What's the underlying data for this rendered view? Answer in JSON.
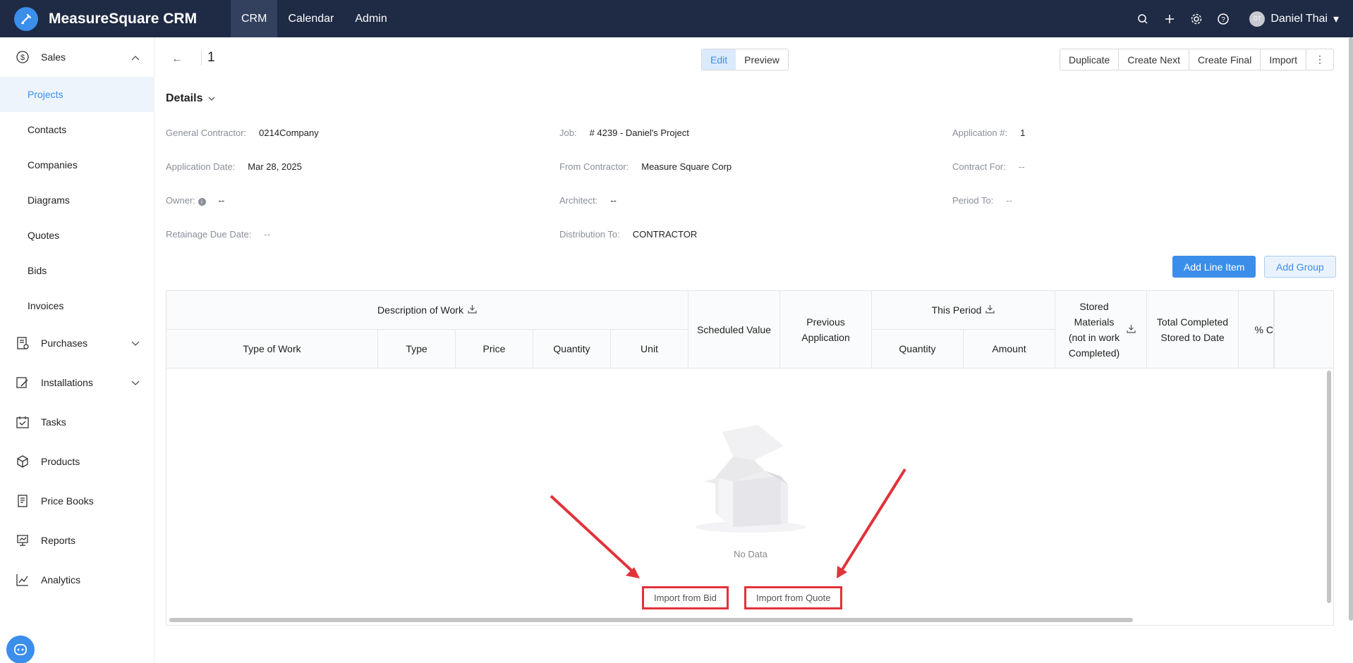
{
  "app": {
    "name": "MeasureSquare CRM"
  },
  "topnav": [
    {
      "label": "CRM"
    },
    {
      "label": "Calendar"
    },
    {
      "label": "Admin"
    }
  ],
  "user": {
    "initials": "DT",
    "name": "Daniel Thai"
  },
  "sidebar": {
    "sales": "Sales",
    "sales_items": [
      "Projects",
      "Contacts",
      "Companies",
      "Diagrams",
      "Quotes",
      "Bids",
      "Invoices"
    ],
    "groups": [
      "Purchases",
      "Installations",
      "Tasks",
      "Products",
      "Price Books",
      "Reports",
      "Analytics"
    ]
  },
  "page": {
    "doc_number": "1",
    "mode_edit": "Edit",
    "mode_preview": "Preview",
    "actions": [
      "Duplicate",
      "Create Next",
      "Create Final",
      "Import"
    ],
    "more": "⋮",
    "details_title": "Details"
  },
  "details": {
    "general_contractor_label": "General Contractor:",
    "general_contractor": "0214Company",
    "application_date_label": "Application Date:",
    "application_date": "Mar 28, 2025",
    "owner_label": "Owner:",
    "owner": "--",
    "retainage_due_label": "Retainage Due Date:",
    "retainage_due": "--",
    "job_label": "Job:",
    "job": "# 4239 - Daniel's Project",
    "from_contractor_label": "From Contractor:",
    "from_contractor": "Measure Square Corp",
    "architect_label": "Architect:",
    "architect": "--",
    "distribution_label": "Distribution To:",
    "distribution": "CONTRACTOR",
    "application_no_label": "Application #:",
    "application_no": "1",
    "contract_for_label": "Contract For:",
    "contract_for": "--",
    "period_to_label": "Period To:",
    "period_to": "--"
  },
  "buttons": {
    "add_line_item": "Add Line Item",
    "add_group": "Add Group"
  },
  "table": {
    "description_of_work": "Description of Work",
    "type_of_work": "Type of Work",
    "type": "Type",
    "price": "Price",
    "quantity": "Quantity",
    "unit": "Unit",
    "scheduled_value": "Scheduled Value",
    "previous_application": "Previous Application",
    "this_period": "This Period",
    "tp_quantity": "Quantity",
    "tp_amount": "Amount",
    "stored_materials": "Stored Materials (not in work Completed)",
    "total_completed": "Total Completed Stored to Date",
    "percent": "% C",
    "no_data": "No Data",
    "import_bid": "Import from Bid",
    "import_quote": "Import from Quote"
  },
  "colors": {
    "brand": "#3b8eea",
    "topbar": "#1f2a44",
    "highlight": "#e2323a"
  }
}
